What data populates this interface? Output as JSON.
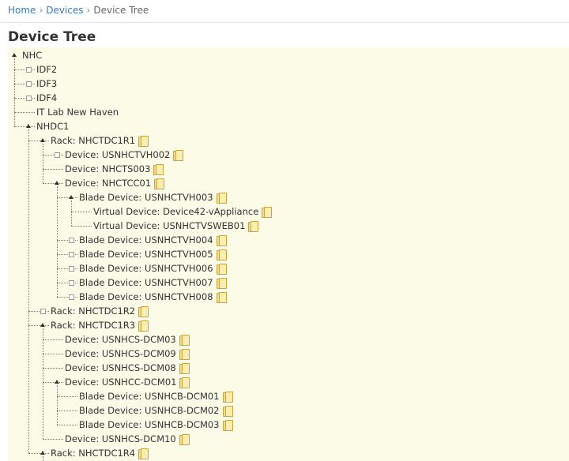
{
  "breadcrumb": {
    "home": "Home",
    "devices": "Devices",
    "current": "Device Tree",
    "separator": "›"
  },
  "page": {
    "title": "Device Tree"
  },
  "colors": {
    "tree_background": "#fbfbe8",
    "link": "#3b7ab7"
  },
  "tree": [
    {
      "label": "NHC",
      "depth": 0,
      "expanded": true,
      "icon": false
    },
    {
      "label": "IDF2",
      "depth": 1,
      "expanded": false,
      "icon": false
    },
    {
      "label": "IDF3",
      "depth": 1,
      "expanded": false,
      "icon": false
    },
    {
      "label": "IDF4",
      "depth": 1,
      "expanded": false,
      "icon": false
    },
    {
      "label": "IT Lab New Haven",
      "depth": 1,
      "expanded": null,
      "icon": false
    },
    {
      "label": "NHDC1",
      "depth": 1,
      "expanded": true,
      "icon": false
    },
    {
      "label": "Rack: NHCTDC1R1",
      "depth": 2,
      "expanded": true,
      "icon": true
    },
    {
      "label": "Device: USNHCTVH002",
      "depth": 3,
      "expanded": false,
      "icon": true
    },
    {
      "label": "Device: NHCTS003",
      "depth": 3,
      "expanded": null,
      "icon": true
    },
    {
      "label": "Device: NHCTCC01",
      "depth": 3,
      "expanded": true,
      "icon": true
    },
    {
      "label": "Blade Device: USNHCTVH003",
      "depth": 4,
      "expanded": true,
      "icon": true
    },
    {
      "label": "Virtual Device: Device42-vAppliance",
      "depth": 5,
      "expanded": null,
      "icon": true
    },
    {
      "label": "Virtual Device: USNHCTVSWEB01",
      "depth": 5,
      "expanded": null,
      "icon": true
    },
    {
      "label": "Blade Device: USNHCTVH004",
      "depth": 4,
      "expanded": false,
      "icon": true
    },
    {
      "label": "Blade Device: USNHCTVH005",
      "depth": 4,
      "expanded": false,
      "icon": true
    },
    {
      "label": "Blade Device: USNHCTVH006",
      "depth": 4,
      "expanded": false,
      "icon": true
    },
    {
      "label": "Blade Device: USNHCTVH007",
      "depth": 4,
      "expanded": false,
      "icon": true
    },
    {
      "label": "Blade Device: USNHCTVH008",
      "depth": 4,
      "expanded": false,
      "icon": true
    },
    {
      "label": "Rack: NHCTDC1R2",
      "depth": 2,
      "expanded": false,
      "icon": true
    },
    {
      "label": "Rack: NHCTDC1R3",
      "depth": 2,
      "expanded": true,
      "icon": true
    },
    {
      "label": "Device: USNHCS-DCM03",
      "depth": 3,
      "expanded": null,
      "icon": true
    },
    {
      "label": "Device: USNHCS-DCM09",
      "depth": 3,
      "expanded": null,
      "icon": true
    },
    {
      "label": "Device: USNHCS-DCM08",
      "depth": 3,
      "expanded": null,
      "icon": true
    },
    {
      "label": "Device: USNHCC-DCM01",
      "depth": 3,
      "expanded": true,
      "icon": true
    },
    {
      "label": "Blade Device: USNHCB-DCM01",
      "depth": 4,
      "expanded": null,
      "icon": true
    },
    {
      "label": "Blade Device: USNHCB-DCM02",
      "depth": 4,
      "expanded": null,
      "icon": true
    },
    {
      "label": "Blade Device: USNHCB-DCM03",
      "depth": 4,
      "expanded": null,
      "icon": true
    },
    {
      "label": "Device: USNHCS-DCM10",
      "depth": 3,
      "expanded": null,
      "icon": true
    },
    {
      "label": "Rack: NHCTDC1R4",
      "depth": 2,
      "expanded": true,
      "icon": true
    }
  ]
}
